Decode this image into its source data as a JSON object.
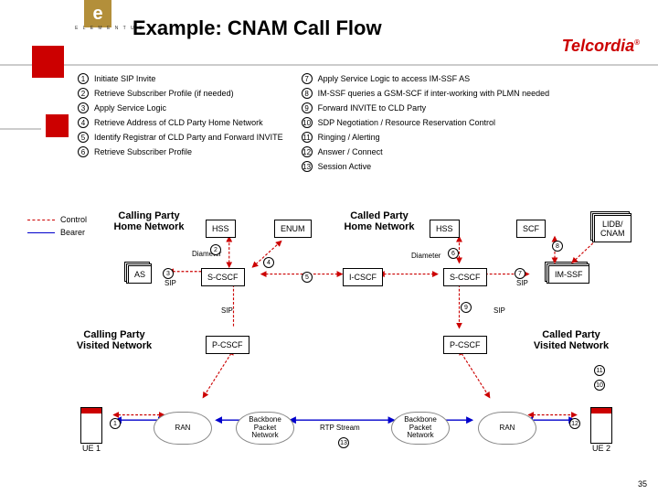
{
  "header": {
    "logo_letter": "e",
    "logo_label": "E L E M E N T U S",
    "title": "Example: CNAM Call Flow",
    "brand": "Telcordia"
  },
  "steps_left": [
    "Initiate SIP Invite",
    "Retrieve Subscriber Profile (if needed)",
    "Apply Service Logic",
    "Retrieve Address of CLD Party Home Network",
    "Identify Registrar of CLD Party and Forward INVITE",
    "Retrieve Subscriber Profile"
  ],
  "steps_right": [
    "Apply Service Logic to access IM-SSF AS",
    "IM-SSF queries a GSM-SCF if inter-working with PLMN needed",
    "Forward INVITE to CLD Party",
    "SDP Negotiation / Resource Reservation Control",
    "Ringing / Alerting",
    "Answer / Connect",
    "Session Active"
  ],
  "legend": {
    "control": "Control",
    "bearer": "Bearer"
  },
  "nodes": {
    "calling_home": "Calling Party\nHome Network",
    "called_home": "Called Party\nHome Network",
    "calling_visited": "Calling Party\nVisited Network",
    "called_visited": "Called Party\nVisited Network",
    "hss1": "HSS",
    "hss2": "HSS",
    "enum": "ENUM",
    "as": "AS",
    "scscf1": "S-CSCF",
    "icscf": "I-CSCF",
    "scscf2": "S-CSCF",
    "imssf": "IM-SSF",
    "scf": "SCF",
    "lidb": "LIDB/\nCNAM",
    "pcscf1": "P-CSCF",
    "pcscf2": "P-CSCF",
    "ue1": "UE 1",
    "ue2": "UE 2",
    "ran1": "RAN",
    "ran2": "RAN",
    "bpn1": "Backbone\nPacket\nNetwork",
    "bpn2": "Backbone\nPacket\nNetwork"
  },
  "link_labels": {
    "diameter1": "Diameter",
    "diameter2": "Diameter",
    "sip1": "SIP",
    "sip2": "SIP",
    "sip3": "SIP",
    "sip4": "SIP",
    "rtp": "RTP Stream"
  },
  "page_number": "35"
}
